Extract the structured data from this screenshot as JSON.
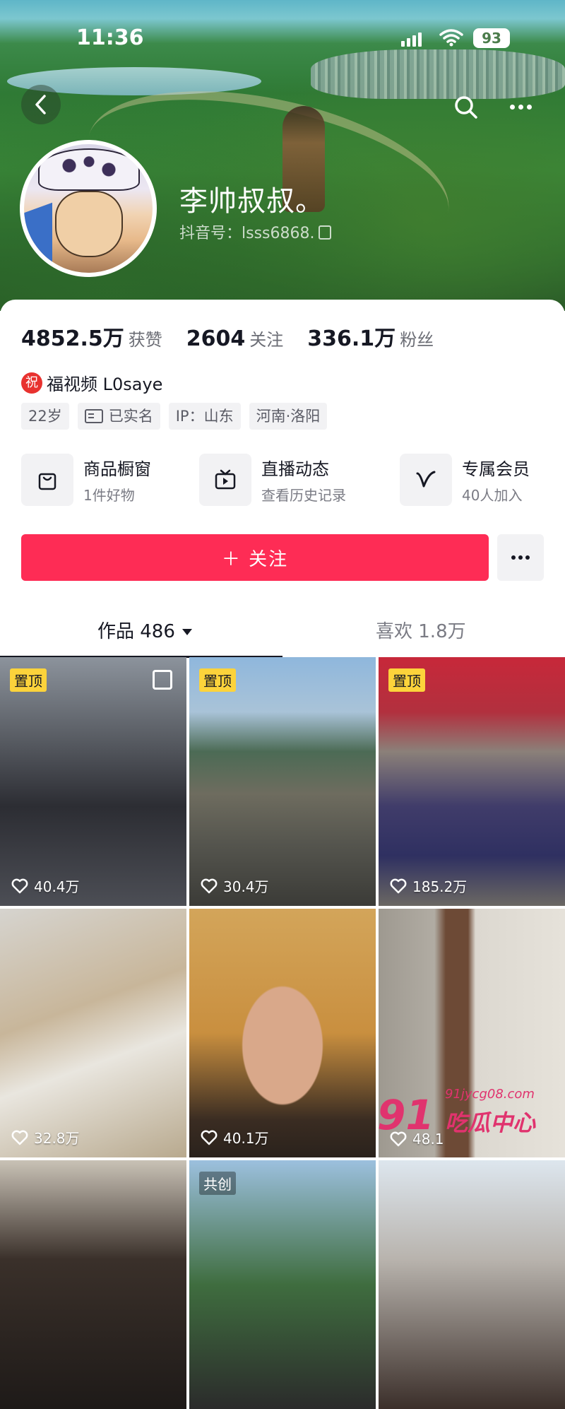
{
  "status_bar": {
    "time": "11:36",
    "battery": "93"
  },
  "profile": {
    "name": "李帅叔叔。",
    "douyin_id": "抖音号：lsss6868."
  },
  "stats": [
    {
      "value": "4852.5万",
      "label": "获赞"
    },
    {
      "value": "2604",
      "label": "关注"
    },
    {
      "value": "336.1万",
      "label": "粉丝"
    }
  ],
  "bio": {
    "badge": "祝",
    "text": "福视频 L0saye"
  },
  "tags": [
    {
      "text": "22岁",
      "icon": null
    },
    {
      "text": "已实名",
      "icon": "id-card-icon"
    },
    {
      "text": "IP：山东",
      "icon": null
    },
    {
      "text": "河南·洛阳",
      "icon": null
    }
  ],
  "features": [
    {
      "title": "商品橱窗",
      "subtitle": "1件好物",
      "icon": "shopping-bag-icon"
    },
    {
      "title": "直播动态",
      "subtitle": "查看历史记录",
      "icon": "tv-icon"
    },
    {
      "title": "专属会员",
      "subtitle": "40人加入",
      "icon": "vip-v-icon"
    }
  ],
  "follow_button": "＋ 关注",
  "tabs": {
    "works": "作品 486",
    "likes": "喜欢 1.8万"
  },
  "videos": [
    {
      "likes": "40.4万",
      "badge": "置顶",
      "multi": true
    },
    {
      "likes": "30.4万",
      "badge": "置顶",
      "multi": false
    },
    {
      "likes": "185.2万",
      "badge": "置顶",
      "multi": false
    },
    {
      "likes": "32.8万",
      "badge": "",
      "multi": false
    },
    {
      "likes": "40.1万",
      "badge": "",
      "multi": false
    },
    {
      "likes": "48.1",
      "badge": "",
      "multi": false
    },
    {
      "likes": "",
      "badge": "",
      "multi": false
    },
    {
      "likes": "",
      "badge": "共创",
      "multi": false
    },
    {
      "likes": "",
      "badge": "",
      "multi": false
    }
  ],
  "watermark": {
    "num": "91",
    "site": "91jycg08.com",
    "name": "吃瓜中心"
  },
  "colors": {
    "accent": "#fe2c55",
    "pin_badge": "#fcd33b",
    "watermark": "#e0336e"
  }
}
